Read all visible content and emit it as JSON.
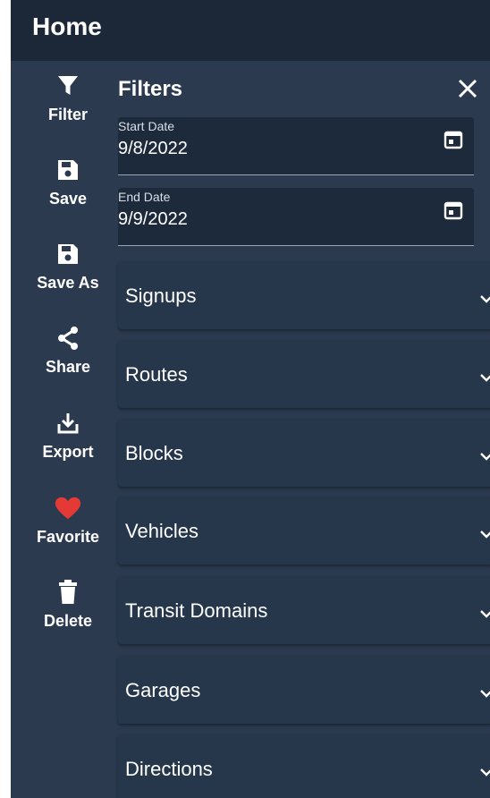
{
  "header": {
    "title": "Home"
  },
  "toolbar": {
    "items": [
      {
        "label": "Filter",
        "icon": "filter-icon"
      },
      {
        "label": "Save",
        "icon": "save-icon"
      },
      {
        "label": "Save As",
        "icon": "save-as-icon"
      },
      {
        "label": "Share",
        "icon": "share-icon"
      },
      {
        "label": "Export",
        "icon": "export-icon"
      },
      {
        "label": "Favorite",
        "icon": "heart-icon"
      },
      {
        "label": "Delete",
        "icon": "trash-icon"
      }
    ]
  },
  "filters": {
    "title": "Filters",
    "start_date": {
      "label": "Start Date",
      "value": "9/8/2022"
    },
    "end_date": {
      "label": "End Date",
      "value": "9/9/2022"
    },
    "sections": [
      "Signups",
      "Routes",
      "Blocks",
      "Vehicles",
      "Transit Domains",
      "Garages",
      "Directions"
    ]
  },
  "colors": {
    "background": "#2b3a4f",
    "header": "#1c2837",
    "favorite": "#e53935"
  }
}
